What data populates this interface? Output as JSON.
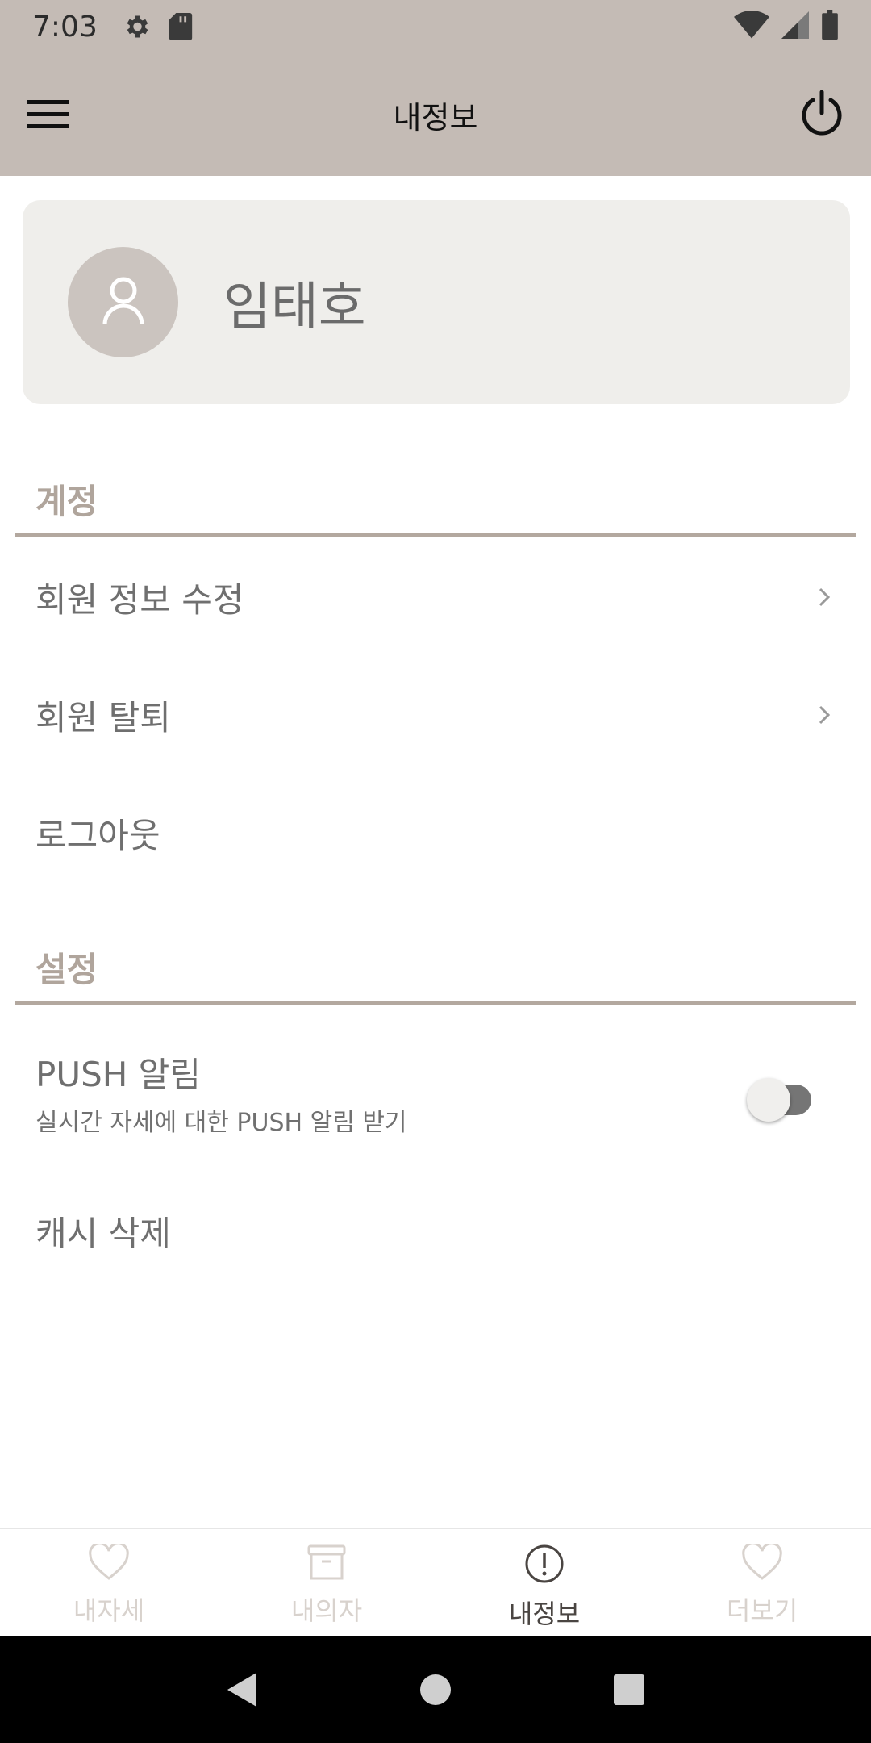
{
  "status_bar": {
    "time": "7:03",
    "icons": [
      "settings-gear-icon",
      "sd-card-icon",
      "wifi-icon",
      "signal-icon",
      "battery-icon"
    ]
  },
  "app_bar": {
    "title": "내정보",
    "left_icon": "hamburger-menu-icon",
    "right_icon": "power-icon"
  },
  "profile": {
    "name": "임태호",
    "avatar_icon": "person-icon"
  },
  "account_section": {
    "title": "계정",
    "items": [
      {
        "label": "회원 정보 수정",
        "has_chevron": true
      },
      {
        "label": "회원 탈퇴",
        "has_chevron": true
      },
      {
        "label": "로그아웃",
        "has_chevron": false
      }
    ]
  },
  "settings_section": {
    "title": "설정",
    "push": {
      "label": "PUSH 알림",
      "description": "실시간 자세에 대한 PUSH 알림 받기",
      "enabled": false
    },
    "clear_cache": {
      "label": "캐시 삭제"
    }
  },
  "bottom_nav": {
    "items": [
      {
        "label": "내자세",
        "icon": "heart-icon",
        "active": false
      },
      {
        "label": "내의자",
        "icon": "archive-box-icon",
        "active": false
      },
      {
        "label": "내정보",
        "icon": "info-alert-icon",
        "active": true
      },
      {
        "label": "더보기",
        "icon": "heart-icon",
        "active": false
      }
    ]
  },
  "colors": {
    "app_bar_bg": "#c4bbb5",
    "section_title": "#b0a59c",
    "divider": "#b3a89f",
    "profile_card_bg": "#efeeeb",
    "avatar_bg": "#cbc4bf",
    "nav_inactive": "#d8d2cd",
    "nav_active": "#4a4542"
  }
}
